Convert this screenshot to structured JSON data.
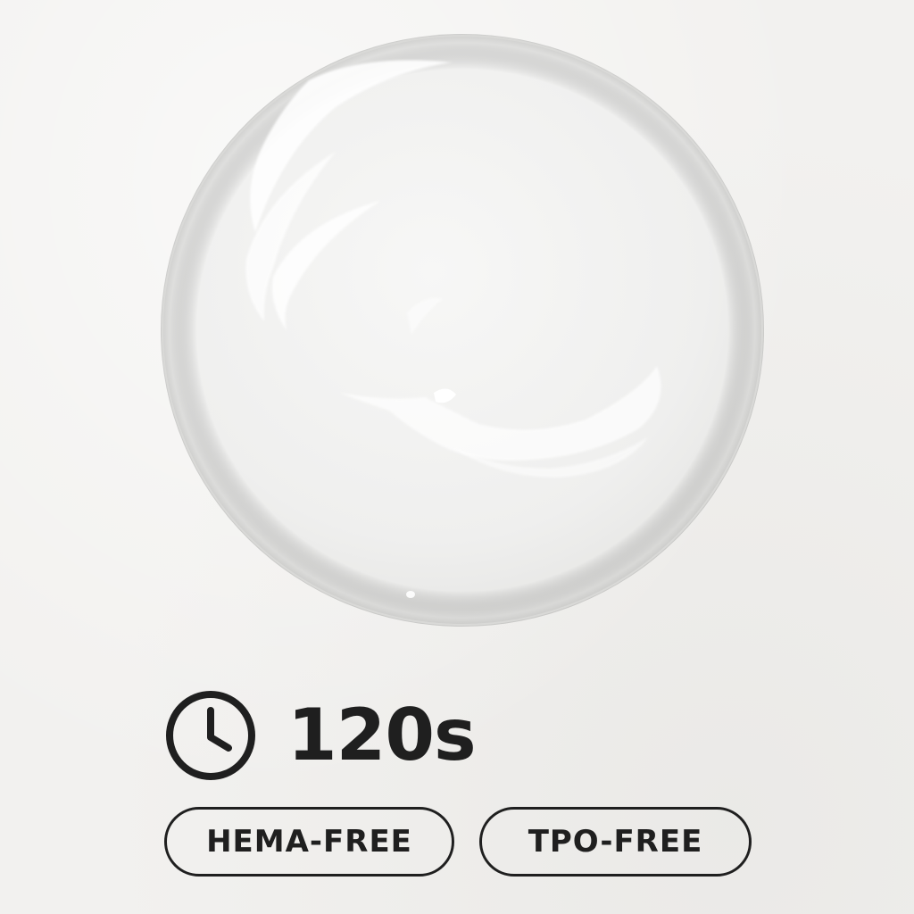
{
  "timer": {
    "icon": "clock-icon",
    "value": "120s"
  },
  "badges": [
    {
      "label": "HEMA-FREE"
    },
    {
      "label": "TPO-FREE"
    }
  ],
  "colors": {
    "background": "#f2f1ef",
    "text": "#1f1f1f",
    "outline": "#1f1f1f"
  }
}
